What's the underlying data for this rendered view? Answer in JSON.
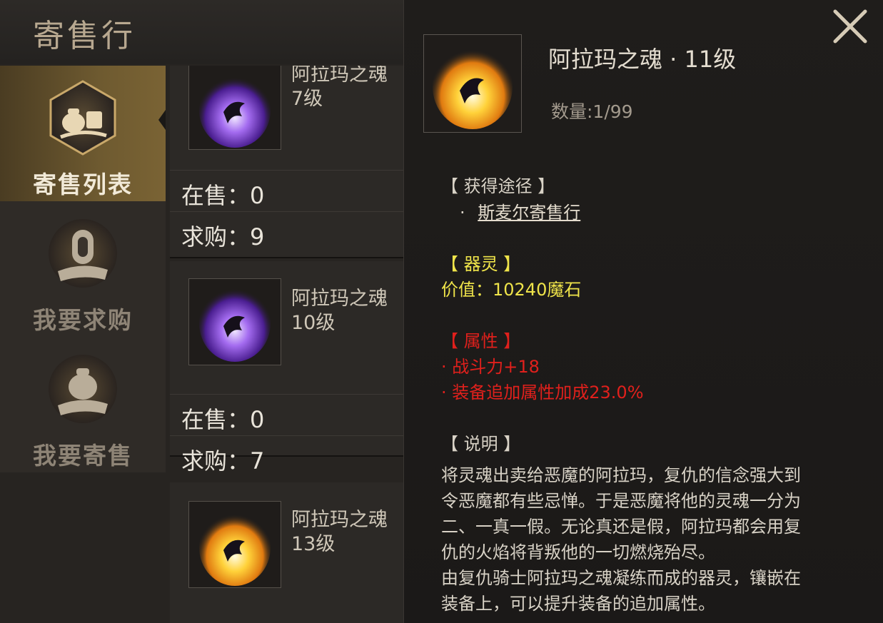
{
  "header": {
    "title": "寄售行"
  },
  "tabs": [
    {
      "label": "寄售列表",
      "icon": "consign-list-icon",
      "active": true
    },
    {
      "label": "我要求购",
      "icon": "buy-request-icon",
      "active": false
    },
    {
      "label": "我要寄售",
      "icon": "sell-item-icon",
      "active": false
    }
  ],
  "list": {
    "items": [
      {
        "name_line1": "阿拉玛之魂",
        "name_line2": "7级",
        "on_sale": "在售：0",
        "wanted": "求购：9",
        "flame": "purple"
      },
      {
        "name_line1": "阿拉玛之魂",
        "name_line2": "10级",
        "on_sale": "在售：0",
        "wanted": "求购：7",
        "flame": "purple"
      },
      {
        "name_line1": "阿拉玛之魂",
        "name_line2": "13级",
        "flame": "gold"
      }
    ]
  },
  "detail": {
    "name": "阿拉玛之魂 · 11级",
    "quantity": "数量:1/99",
    "source_header": "【 获得途径 】",
    "source_bullet": "·",
    "source_link": "斯麦尔寄售行",
    "spirit_header": "【 器灵 】",
    "spirit_value": "价值：10240魔石",
    "attr_header": "【 属性 】",
    "attr_1": "· 战斗力+18",
    "attr_2": "· 装备追加属性加成23.0%",
    "desc_header": "【 说明 】",
    "desc_lines": [
      "将灵魂出卖给恶魔的阿拉玛，复仇的信念强大到",
      "令恶魔都有些忌惮。于是恶魔将他的灵魂一分为",
      "二、一真一假。无论真还是假，阿拉玛都会用复",
      "仇的火焰将背叛他的一切燃烧殆尽。",
      "由复仇骑士阿拉玛之魂凝练而成的器灵，镶嵌在",
      "装备上，可以提升装备的追加属性。"
    ]
  },
  "colors": {
    "gold_text": "#efe44a",
    "red_text": "#e0201c",
    "active_tab": "#7a6334"
  }
}
